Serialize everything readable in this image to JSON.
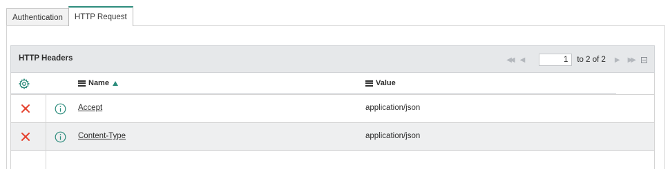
{
  "tabs": [
    {
      "label": "Authentication",
      "active": false
    },
    {
      "label": "HTTP Request",
      "active": true
    }
  ],
  "related_list": {
    "title": "HTTP Headers",
    "pager": {
      "current_page": "1",
      "range_text": "to 2 of 2"
    }
  },
  "table": {
    "columns": [
      {
        "label": "Name",
        "sorted": "ascending"
      },
      {
        "label": "Value"
      }
    ],
    "rows": [
      {
        "name": "Accept",
        "value": "application/json"
      },
      {
        "name": "Content-Type",
        "value": "application/json"
      }
    ]
  },
  "colors": {
    "accent": "#2c8c7c",
    "delete": "#e5412d",
    "header_bg": "#e6e8ea",
    "row_alt_bg": "#eeeff0"
  },
  "icons": {
    "settings": "gear-icon",
    "column_menu": "hamburger-icon",
    "sort": "sort-asc-icon",
    "row_delete": "delete-icon",
    "row_info": "info-icon",
    "pager_first": "first-page-icon",
    "pager_prev": "prev-page-icon",
    "pager_next": "next-page-icon",
    "pager_last": "last-page-icon",
    "collapse": "collapse-icon"
  }
}
